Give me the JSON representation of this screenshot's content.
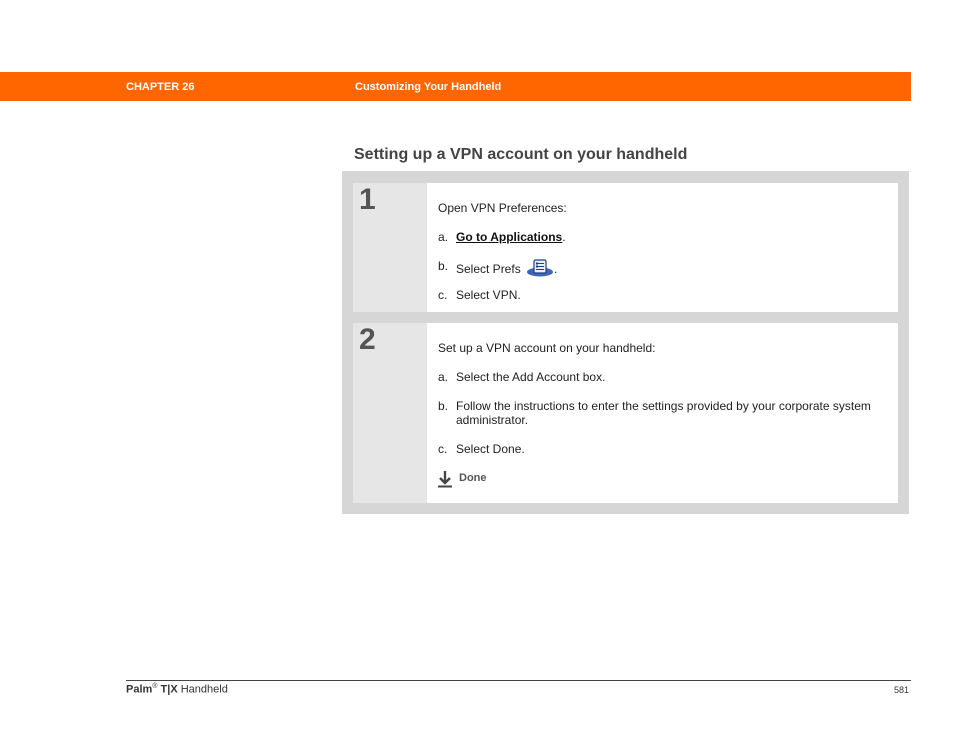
{
  "header": {
    "chapter": "CHAPTER 26",
    "chapter_title": "Customizing Your Handheld",
    "bar_color": "#ff6600"
  },
  "section_title": "Setting up a VPN account on your handheld",
  "steps": [
    {
      "number": "1",
      "intro": "Open VPN Preferences:",
      "items": [
        {
          "letter": "a.",
          "link": "Go to Applications",
          "suffix": "."
        },
        {
          "letter": "b.",
          "text": "Select Prefs",
          "icon": "prefs-icon",
          "suffix": "."
        },
        {
          "letter": "c.",
          "text": "Select VPN."
        }
      ]
    },
    {
      "number": "2",
      "intro": "Set up a VPN account on your handheld:",
      "items": [
        {
          "letter": "a.",
          "text": "Select the Add Account box."
        },
        {
          "letter": "b.",
          "text": "Follow the instructions to enter the settings provided by your corporate system administrator."
        },
        {
          "letter": "c.",
          "text": "Select Done."
        }
      ],
      "done_label": "Done",
      "done_icon": "done-arrow-icon"
    }
  ],
  "footer": {
    "brand": "Palm",
    "reg": "®",
    "model": "T|X",
    "product": "Handheld",
    "page_number": "581"
  }
}
